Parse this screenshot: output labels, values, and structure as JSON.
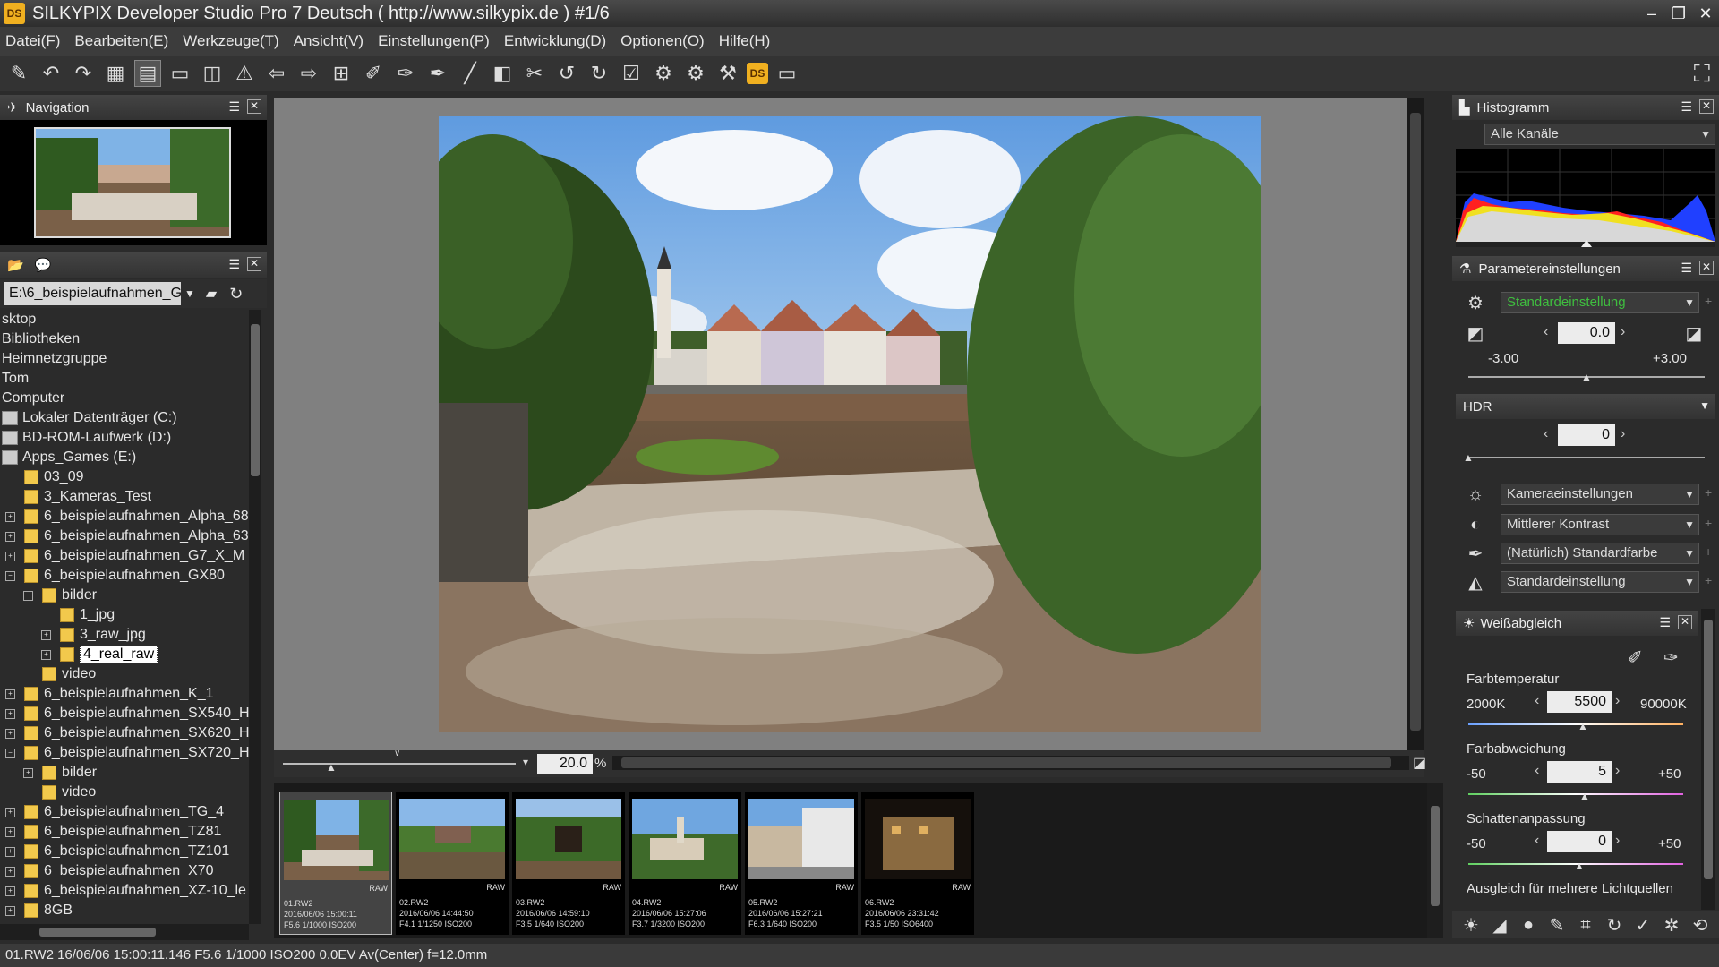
{
  "window": {
    "title": "SILKYPIX Developer Studio Pro 7 Deutsch ( http://www.silkypix.de )   #1/6",
    "app_icon_label": "DS"
  },
  "menu": [
    "Datei(F)",
    "Bearbeiten(E)",
    "Werkzeuge(T)",
    "Ansicht(V)",
    "Einstellungen(P)",
    "Entwicklung(D)",
    "Optionen(O)",
    "Hilfe(H)"
  ],
  "toolbar": {
    "icons": [
      "brush-icon",
      "undo-icon",
      "redo-icon",
      "grid-view-icon",
      "combo-view-icon",
      "single-view-icon",
      "compare-view-icon",
      "warning-icon",
      "rotate-back-icon",
      "forward-icon",
      "crop-icon",
      "picker-icon",
      "picker2-icon",
      "picker3-icon",
      "pen-icon",
      "eraser-icon",
      "scissors-icon",
      "rotate-left-icon",
      "rotate-right-icon",
      "check-icon",
      "settings-icon",
      "settings2-icon",
      "hammer-icon",
      "ds-icon",
      "monitor-icon"
    ],
    "ds_label": "DS"
  },
  "navigation": {
    "title": "Navigation"
  },
  "folder": {
    "path": "E:\\6_beispielaufnahmen_G",
    "tree": [
      {
        "label": "sktop",
        "indent": 0,
        "type": "none"
      },
      {
        "label": "Bibliotheken",
        "indent": 0,
        "type": "none"
      },
      {
        "label": "Heimnetzgruppe",
        "indent": 0,
        "type": "none"
      },
      {
        "label": "Tom",
        "indent": 0,
        "type": "none"
      },
      {
        "label": "Computer",
        "indent": 0,
        "type": "none"
      },
      {
        "label": "Lokaler Datenträger (C:)",
        "indent": 0,
        "type": "drive"
      },
      {
        "label": "BD-ROM-Laufwerk (D:)",
        "indent": 0,
        "type": "drive"
      },
      {
        "label": "Apps_Games (E:)",
        "indent": 0,
        "type": "drive"
      },
      {
        "label": "03_09",
        "indent": 1,
        "type": "folder"
      },
      {
        "label": "3_Kameras_Test",
        "indent": 1,
        "type": "folder"
      },
      {
        "label": "6_beispielaufnahmen_Alpha_68",
        "indent": 1,
        "type": "folder",
        "exp": "+"
      },
      {
        "label": "6_beispielaufnahmen_Alpha_63",
        "indent": 1,
        "type": "folder",
        "exp": "+"
      },
      {
        "label": "6_beispielaufnahmen_G7_X_M",
        "indent": 1,
        "type": "folder",
        "exp": "+"
      },
      {
        "label": "6_beispielaufnahmen_GX80",
        "indent": 1,
        "type": "folder",
        "exp": "−"
      },
      {
        "label": "bilder",
        "indent": 2,
        "type": "folder",
        "exp": "−"
      },
      {
        "label": "1_jpg",
        "indent": 3,
        "type": "folder"
      },
      {
        "label": "3_raw_jpg",
        "indent": 3,
        "type": "folder",
        "exp": "+"
      },
      {
        "label": "4_real_raw",
        "indent": 3,
        "type": "folder",
        "exp": "+",
        "selected": true
      },
      {
        "label": "video",
        "indent": 2,
        "type": "folder"
      },
      {
        "label": "6_beispielaufnahmen_K_1",
        "indent": 1,
        "type": "folder",
        "exp": "+"
      },
      {
        "label": "6_beispielaufnahmen_SX540_H",
        "indent": 1,
        "type": "folder",
        "exp": "+"
      },
      {
        "label": "6_beispielaufnahmen_SX620_H",
        "indent": 1,
        "type": "folder",
        "exp": "+"
      },
      {
        "label": "6_beispielaufnahmen_SX720_H",
        "indent": 1,
        "type": "folder",
        "exp": "−"
      },
      {
        "label": "bilder",
        "indent": 2,
        "type": "folder",
        "exp": "+"
      },
      {
        "label": "video",
        "indent": 2,
        "type": "folder"
      },
      {
        "label": "6_beispielaufnahmen_TG_4",
        "indent": 1,
        "type": "folder",
        "exp": "+"
      },
      {
        "label": "6_beispielaufnahmen_TZ81",
        "indent": 1,
        "type": "folder",
        "exp": "+"
      },
      {
        "label": "6_beispielaufnahmen_TZ101",
        "indent": 1,
        "type": "folder",
        "exp": "+"
      },
      {
        "label": "6_beispielaufnahmen_X70",
        "indent": 1,
        "type": "folder",
        "exp": "+"
      },
      {
        "label": "6_beispielaufnahmen_XZ-10_le",
        "indent": 1,
        "type": "folder",
        "exp": "+"
      },
      {
        "label": "8GB",
        "indent": 1,
        "type": "folder",
        "exp": "+"
      }
    ]
  },
  "viewer": {
    "zoom_value": "20.0",
    "zoom_unit": "%"
  },
  "filmstrip": [
    {
      "name": "01.RW2",
      "date": "2016/06/06 15:00:11",
      "exif": "F5.6 1/1000 ISO200",
      "raw": "RAW",
      "scene": "river"
    },
    {
      "name": "02.RW2",
      "date": "2016/06/06 14:44:50",
      "exif": "F4.1 1/1250 ISO200",
      "raw": "RAW",
      "scene": "green"
    },
    {
      "name": "03.RW2",
      "date": "2016/06/06 14:59:10",
      "exif": "F3.5 1/640 ISO200",
      "raw": "RAW",
      "scene": "tree"
    },
    {
      "name": "04.RW2",
      "date": "2016/06/06 15:27:06",
      "exif": "F3.7 1/3200 ISO200",
      "raw": "RAW",
      "scene": "town"
    },
    {
      "name": "05.RW2",
      "date": "2016/06/06 15:27:21",
      "exif": "F6.3 1/640 ISO200",
      "raw": "RAW",
      "scene": "street"
    },
    {
      "name": "06.RW2",
      "date": "2016/06/06 23:31:42",
      "exif": "F3.5 1/50 ISO6400",
      "raw": "RAW",
      "scene": "night"
    }
  ],
  "histogram": {
    "title": "Histogramm",
    "channel": "Alle Kanäle"
  },
  "params": {
    "title": "Parametereinstellungen",
    "preset": "Standardeinstellung",
    "exposure_value": "0.0",
    "exposure_min": "-3.00",
    "exposure_max": "+3.00",
    "exposure_level": 0,
    "hdr_label": "HDR",
    "hdr_value": "0",
    "camera": "Kameraeinstellungen",
    "contrast": "Mittlerer Kontrast",
    "color": "(Natürlich) Standardfarbe",
    "sharpness": "Standardeinstellung"
  },
  "wb": {
    "title": "Weißabgleich",
    "temp_label": "Farbtemperatur",
    "temp_min": "2000K",
    "temp_max": "90000K",
    "temp_value": "5500",
    "dev_label": "Farbabweichung",
    "dev_min": "-50",
    "dev_max": "+50",
    "dev_value": "5",
    "shadow_label": "Schattenanpassung",
    "shadow_min": "-50",
    "shadow_max": "+50",
    "shadow_value": "0",
    "multi_label": "Ausgleich für mehrere Lichtquellen"
  },
  "status": "01.RW2 16/06/06 15:00:11.146 F5.6 1/1000 ISO200  0.0EV Av(Center) f=12.0mm",
  "colors": {
    "preset_green": "#3fbf3f",
    "accent_yellow": "#f0b020"
  }
}
